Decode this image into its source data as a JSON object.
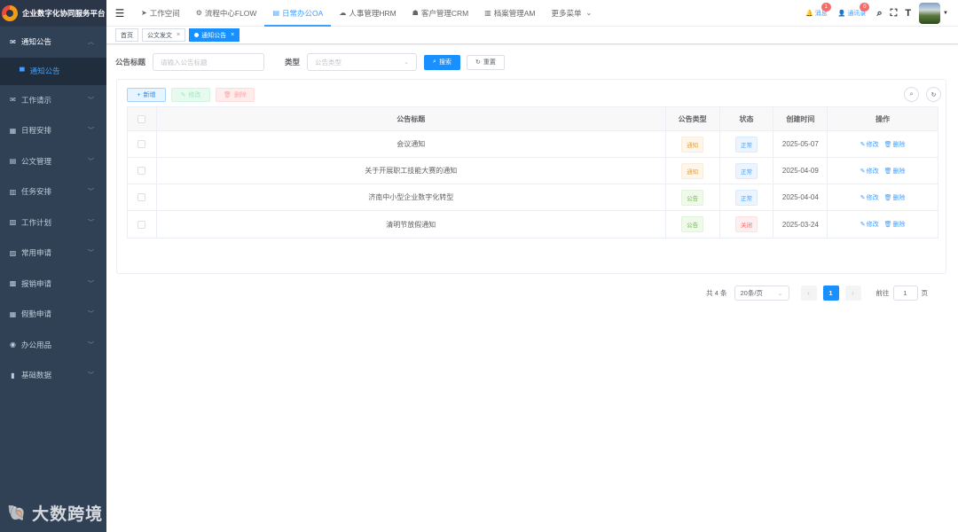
{
  "app": {
    "title": "企业数字化协同服务平台",
    "watermark": "大数跨境",
    "watermark_mark": "🐚"
  },
  "sidebar": {
    "items": [
      {
        "label": "通知公告",
        "icon": "mail-icon",
        "glyph": "✉",
        "open": true
      },
      {
        "label": "工作请示",
        "icon": "mail-icon",
        "glyph": "✉"
      },
      {
        "label": "日程安排",
        "icon": "calendar-icon",
        "glyph": "▦"
      },
      {
        "label": "公文管理",
        "icon": "document-icon",
        "glyph": "▤"
      },
      {
        "label": "任务安排",
        "icon": "task-icon",
        "glyph": "▥"
      },
      {
        "label": "工作计划",
        "icon": "plan-icon",
        "glyph": "▧"
      },
      {
        "label": "常用申请",
        "icon": "form-icon",
        "glyph": "▨"
      },
      {
        "label": "报销申请",
        "icon": "receipt-icon",
        "glyph": "▩"
      },
      {
        "label": "假勤申请",
        "icon": "grid-icon",
        "glyph": "▦"
      },
      {
        "label": "办公用品",
        "icon": "cog-icon",
        "glyph": "◉"
      },
      {
        "label": "基础数据",
        "icon": "bar-chart-icon",
        "glyph": "▮"
      }
    ],
    "sub_active": {
      "label": "通知公告",
      "icon": "message-icon",
      "glyph": "▀"
    }
  },
  "topnav": {
    "items": [
      {
        "label": "工作空间",
        "glyph": "➤"
      },
      {
        "label": "流程中心FLOW",
        "glyph": "⚙"
      },
      {
        "label": "日常办公OA",
        "glyph": "▤",
        "active": true
      },
      {
        "label": "人事管理HRM",
        "glyph": "☁"
      },
      {
        "label": "客户管理CRM",
        "glyph": "☗"
      },
      {
        "label": "档案管理AM",
        "glyph": "▥"
      },
      {
        "label": "更多菜单",
        "glyph": ""
      }
    ],
    "more_caret": "⌄"
  },
  "topright": {
    "message_label": "消息",
    "message_count": "1",
    "contacts_label": "通讯录",
    "contacts_count": "0"
  },
  "tags": [
    {
      "label": "首页"
    },
    {
      "label": "公文发文"
    },
    {
      "label": "通知公告",
      "active": true
    }
  ],
  "search": {
    "title_label": "公告标题",
    "title_placeholder": "请输入公告标题",
    "type_label": "类型",
    "type_placeholder": "公告类型",
    "search_button": "搜索",
    "reset_button": "重置"
  },
  "toolbar": {
    "add": "新增",
    "edit": "修改",
    "delete": "删除"
  },
  "table": {
    "headers": [
      "公告标题",
      "公告类型",
      "状态",
      "创建时间",
      "操作"
    ],
    "rows": [
      {
        "title": "会议通知",
        "type": "通知",
        "type_style": "warn",
        "status": "正常",
        "status_style": "info",
        "created": "2025-05-07"
      },
      {
        "title": "关于开展职工技能大赛的通知",
        "type": "通知",
        "type_style": "warn",
        "status": "正常",
        "status_style": "info",
        "created": "2025-04-09"
      },
      {
        "title": "济南中小型企业数字化转型",
        "type": "公告",
        "type_style": "success",
        "status": "正常",
        "status_style": "info",
        "created": "2025-04-04"
      },
      {
        "title": "清明节放假通知",
        "type": "公告",
        "type_style": "success",
        "status": "关闭",
        "status_style": "danger",
        "created": "2025-03-24"
      }
    ],
    "op_edit": "修改",
    "op_delete": "删除"
  },
  "pagination": {
    "total": "共 4 条",
    "page_size": "20条/页",
    "current_page": "1",
    "goto_label": "前往",
    "goto_value": "1",
    "goto_suffix": "页"
  },
  "colors": {
    "sidebar_bg": "#304156",
    "primary": "#1890ff",
    "danger": "#f56c6c",
    "warning": "#e6a23c",
    "success": "#67c23a"
  }
}
